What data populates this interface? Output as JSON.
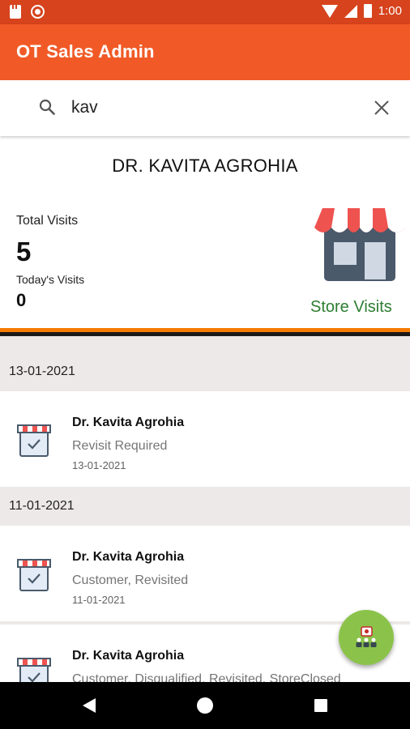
{
  "status_bar": {
    "time": "1:00",
    "icons": [
      "sd-card-icon",
      "record-icon",
      "wifi-icon",
      "signal-icon",
      "battery-icon"
    ]
  },
  "app_bar": {
    "title": "OT Sales Admin",
    "color": "#f15a27"
  },
  "search": {
    "value": "kav",
    "icon": "search-icon",
    "clear_icon": "close-icon"
  },
  "profile": {
    "name": "DR. KAVITA AGROHIA",
    "total_visits_label": "Total Visits",
    "total_visits": "5",
    "todays_visits_label": "Today's Visits",
    "todays_visits": "0",
    "store_visits_label": "Store Visits",
    "store_visits_color": "#2e7d32"
  },
  "visits": {
    "groups": [
      {
        "date": "13-01-2021",
        "items": [
          {
            "name": "Dr. Kavita Agrohia",
            "status": "Revisit Required",
            "date": "13-01-2021"
          }
        ]
      },
      {
        "date": "11-01-2021",
        "items": [
          {
            "name": "Dr. Kavita Agrohia",
            "status": "Customer, Revisited",
            "date": "11-01-2021"
          },
          {
            "name": "Dr. Kavita Agrohia",
            "status": "Customer, Disqualified, Revisited, StoreClosed",
            "date": ""
          }
        ]
      }
    ]
  },
  "fab": {
    "icon": "team-icon",
    "color": "#8bc34a"
  },
  "nav_bar": {
    "icons": [
      "back-icon",
      "home-icon",
      "recents-icon"
    ]
  }
}
